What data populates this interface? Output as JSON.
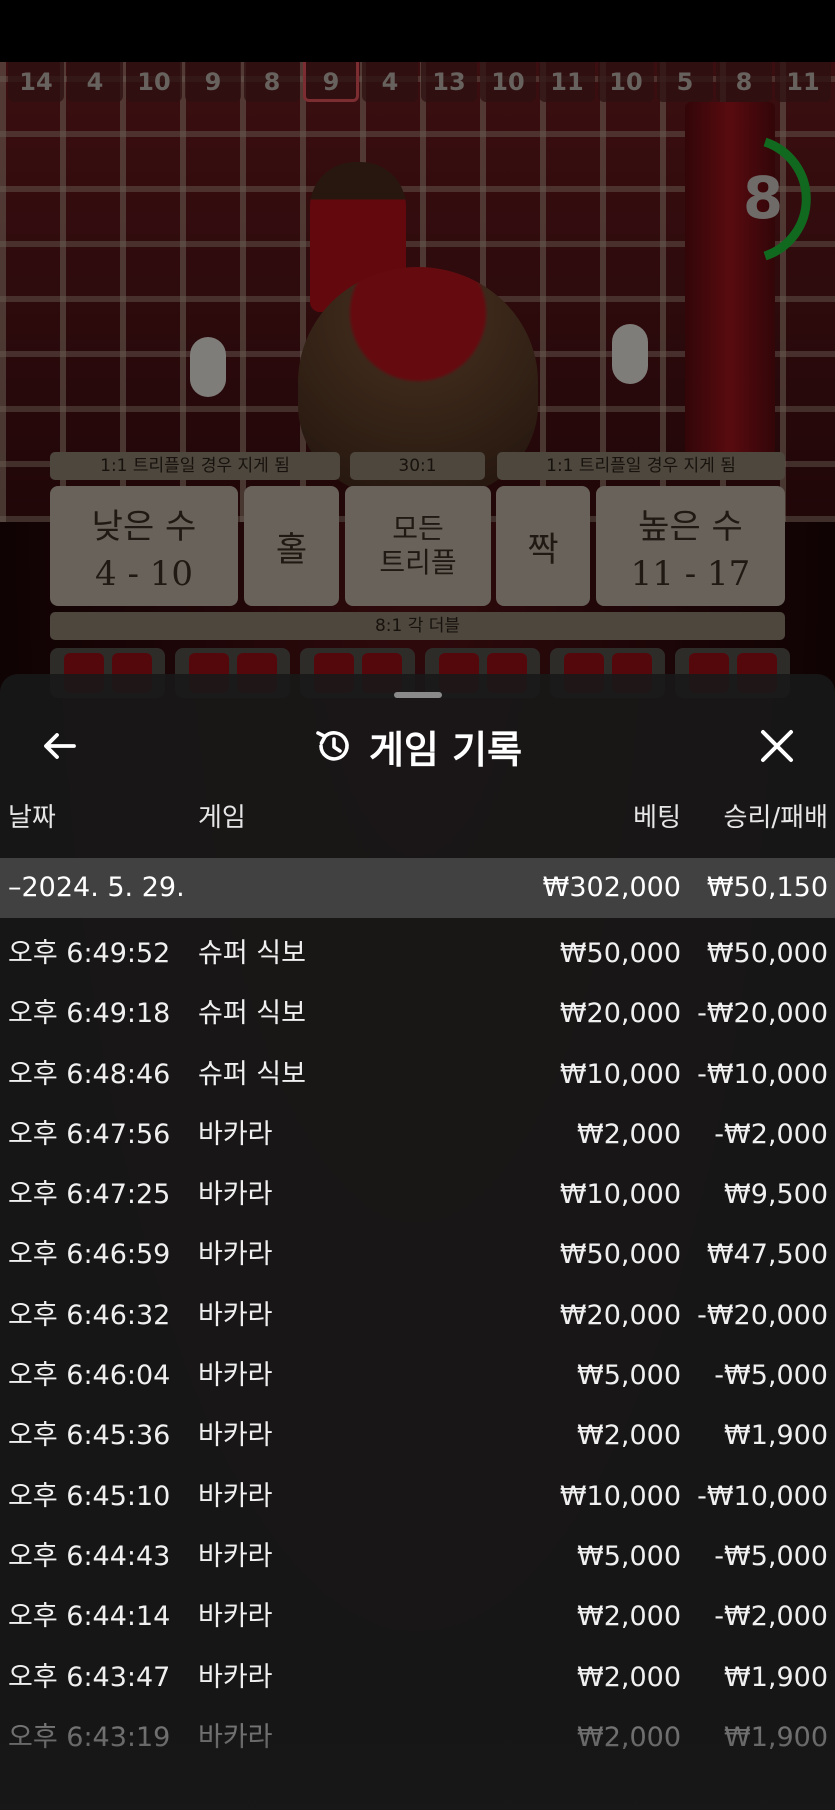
{
  "game": {
    "history_numbers": [
      "14",
      "4",
      "10",
      "9",
      "8",
      "9",
      "4",
      "13",
      "10",
      "11",
      "10",
      "5",
      "8",
      "11"
    ],
    "highlighted_index": 5,
    "countdown": "8",
    "labels": {
      "left_note": "1:1 트리플일 경우 지게 됨",
      "mid_note": "30:1",
      "right_note": "1:1 트리플일 경우 지게 됨",
      "double_note": "8:1 각 더블"
    },
    "bets": {
      "small": {
        "line1": "낮은 수",
        "line2": "4 - 10"
      },
      "odd": "홀",
      "any_triple": {
        "line1": "모든",
        "line2": "트리플"
      },
      "even": "짝",
      "big": {
        "line1": "높은 수",
        "line2": "11 - 17"
      }
    },
    "colors": {
      "felt_red": "#9b1016",
      "timer_green": "#1fbf3a",
      "label_gold": "#8d8170"
    }
  },
  "modal": {
    "title": "게임 기록",
    "icons": {
      "back": "arrow-left-icon",
      "title": "history-icon",
      "close": "close-icon"
    },
    "columns": {
      "date": "날짜",
      "game": "게임",
      "bet": "베팅",
      "result": "승리/패배"
    },
    "summary": {
      "date": "–2024. 5. 29.",
      "bet": "₩302,000",
      "result": "₩50,150"
    },
    "rows": [
      {
        "time": "오후 6:49:52",
        "game": "슈퍼 식보",
        "bet": "₩50,000",
        "result": "₩50,000"
      },
      {
        "time": "오후 6:49:18",
        "game": "슈퍼 식보",
        "bet": "₩20,000",
        "result": "-₩20,000"
      },
      {
        "time": "오후 6:48:46",
        "game": "슈퍼 식보",
        "bet": "₩10,000",
        "result": "-₩10,000"
      },
      {
        "time": "오후 6:47:56",
        "game": "바카라",
        "bet": "₩2,000",
        "result": "-₩2,000"
      },
      {
        "time": "오후 6:47:25",
        "game": "바카라",
        "bet": "₩10,000",
        "result": "₩9,500"
      },
      {
        "time": "오후 6:46:59",
        "game": "바카라",
        "bet": "₩50,000",
        "result": "₩47,500"
      },
      {
        "time": "오후 6:46:32",
        "game": "바카라",
        "bet": "₩20,000",
        "result": "-₩20,000"
      },
      {
        "time": "오후 6:46:04",
        "game": "바카라",
        "bet": "₩5,000",
        "result": "-₩5,000"
      },
      {
        "time": "오후 6:45:36",
        "game": "바카라",
        "bet": "₩2,000",
        "result": "₩1,900"
      },
      {
        "time": "오후 6:45:10",
        "game": "바카라",
        "bet": "₩10,000",
        "result": "-₩10,000"
      },
      {
        "time": "오후 6:44:43",
        "game": "바카라",
        "bet": "₩5,000",
        "result": "-₩5,000"
      },
      {
        "time": "오후 6:44:14",
        "game": "바카라",
        "bet": "₩2,000",
        "result": "-₩2,000"
      },
      {
        "time": "오후 6:43:47",
        "game": "바카라",
        "bet": "₩2,000",
        "result": "₩1,900"
      },
      {
        "time": "오후 6:43:19",
        "game": "바카라",
        "bet": "₩2,000",
        "result": "₩1,900"
      }
    ]
  }
}
